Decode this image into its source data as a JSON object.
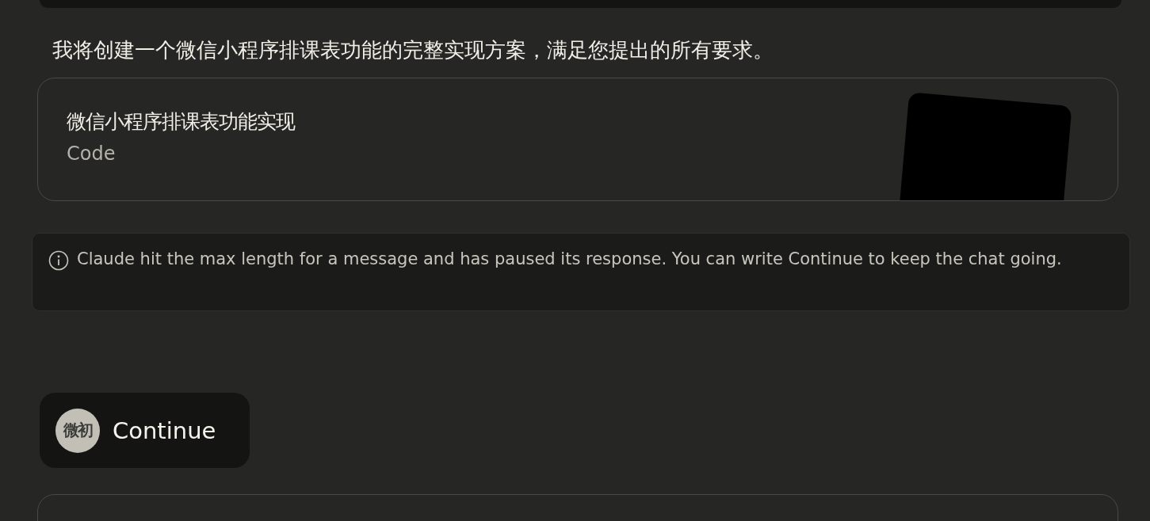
{
  "response_text": "我将创建一个微信小程序排课表功能的完整实现方案，满足您提出的所有要求。",
  "artifact": {
    "title": "微信小程序排课表功能实现",
    "type": "Code"
  },
  "notice": {
    "text": "Claude hit the max length for a message and has paused its response. You can write Continue to keep the chat going."
  },
  "user_message": {
    "avatar_initials": "微初",
    "text": "Continue"
  }
}
